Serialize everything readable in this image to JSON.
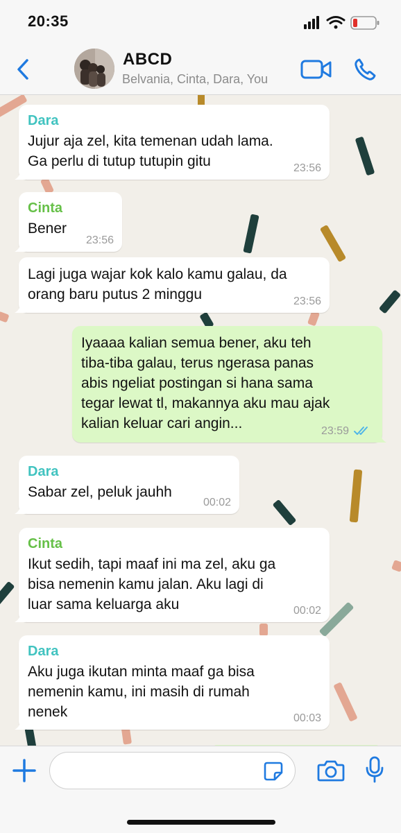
{
  "status_bar": {
    "time": "20:35"
  },
  "header": {
    "title": "ABCD",
    "members": "Belvania, Cinta, Dara, You",
    "accent": "#1f7ae0"
  },
  "messages": [
    {
      "sender": "Dara",
      "text": "Jujur aja zel, kita temenan udah lama.\nGa perlu di tutup tutupin gitu",
      "time": "23:56"
    },
    {
      "sender": "Cinta",
      "text": "Bener",
      "time": "23:56"
    },
    {
      "sender": "",
      "text": "Lagi juga wajar kok kalo kamu galau, da\norang baru putus 2 minggu",
      "time": "23:56"
    },
    {
      "sender": "You",
      "text": "Iyaaaa kalian semua bener, aku teh\ntiba-tiba galau, terus ngerasa panas\nabis ngeliat postingan si hana sama\ntegar lewat tl, makannya aku mau ajak\nkalian keluar cari angin...",
      "time": "23:59",
      "status": "read"
    },
    {
      "sender": "Dara",
      "text": "Sabar zel, peluk jauhh",
      "time": "00:02"
    },
    {
      "sender": "Cinta",
      "text": "Ikut sedih, tapi maaf ini ma zel, aku ga\nbisa nemenin kamu jalan. Aku lagi di\nluar sama keluarga aku",
      "time": "00:02"
    },
    {
      "sender": "Dara",
      "text": "Aku juga ikutan minta maaf ga bisa\nnemenin kamu, ini masih di rumah\nnenek",
      "time": "00:03"
    }
  ],
  "composer": {
    "placeholder": ""
  },
  "icons": {
    "back": "chevron-left-icon",
    "video": "video-camera-icon",
    "call": "phone-icon",
    "add": "plus-icon",
    "sticker": "sticker-icon",
    "camera": "camera-icon",
    "mic": "microphone-icon"
  },
  "colors": {
    "dara": "#41c3c0",
    "cinta": "#66c048",
    "outgoing_bubble": "#dcf8c6",
    "read_ticks": "#4fb5e8"
  }
}
